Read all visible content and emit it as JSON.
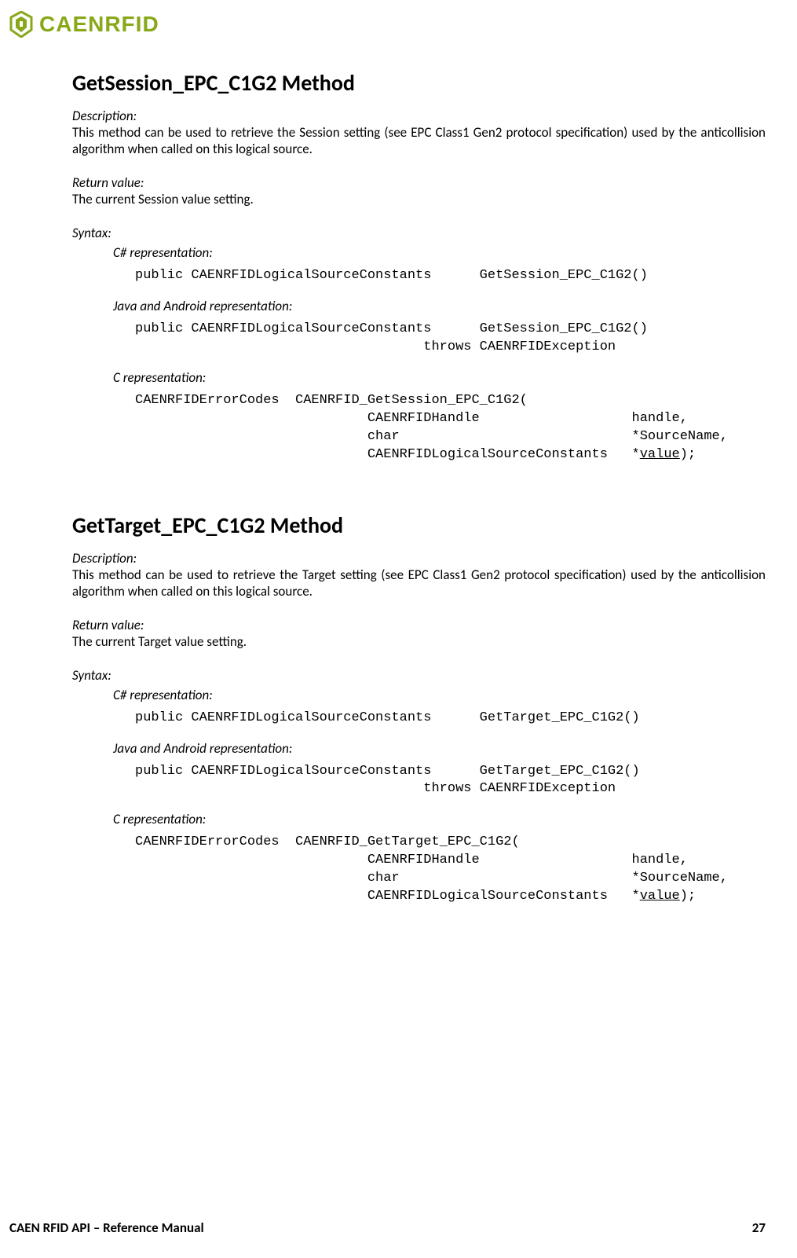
{
  "brand": {
    "name": "CAENRFID"
  },
  "footer": {
    "left": "CAEN RFID API – Reference Manual",
    "page": "27"
  },
  "sections": [
    {
      "title": "GetSession_EPC_C1G2 Method",
      "descLabel": "Description:",
      "desc": "This method can be used to retrieve the Session setting (see EPC Class1 Gen2 protocol specification) used by the anticollision algorithm when called on this logical source.",
      "retLabel": "Return value:",
      "ret": "The current Session value setting.",
      "syntaxLabel": "Syntax:",
      "reps": {
        "csharpLabel": "C# representation:",
        "csharp": "public CAENRFIDLogicalSourceConstants      GetSession_EPC_C1G2()",
        "javaLabel": "Java and Android representation:",
        "java": "public CAENRFIDLogicalSourceConstants      GetSession_EPC_C1G2()\n                                    throws CAENRFIDException",
        "cLabel": "C representation:",
        "c_pre": "CAENRFIDErrorCodes  CAENRFID_GetSession_EPC_C1G2(\n                             CAENRFIDHandle                   handle,\n                             char                             *SourceName,\n                             CAENRFIDLogicalSourceConstants   *",
        "c_ul": "value",
        "c_post": ");"
      }
    },
    {
      "title": "GetTarget_EPC_C1G2 Method",
      "descLabel": "Description:",
      "desc": "This method can be used to retrieve the Target setting (see EPC Class1 Gen2 protocol specification) used by the anticollision algorithm when called on this logical source.",
      "retLabel": "Return value:",
      "ret": "The current Target value setting.",
      "syntaxLabel": "Syntax:",
      "reps": {
        "csharpLabel": "C# representation:",
        "csharp": "public CAENRFIDLogicalSourceConstants      GetTarget_EPC_C1G2()",
        "javaLabel": "Java and Android representation:",
        "java": "public CAENRFIDLogicalSourceConstants      GetTarget_EPC_C1G2()\n                                    throws CAENRFIDException",
        "cLabel": "C representation:",
        "c_pre": "CAENRFIDErrorCodes  CAENRFID_GetTarget_EPC_C1G2(\n                             CAENRFIDHandle                   handle,\n                             char                             *SourceName,\n                             CAENRFIDLogicalSourceConstants   *",
        "c_ul": "value",
        "c_post": ");"
      }
    }
  ]
}
